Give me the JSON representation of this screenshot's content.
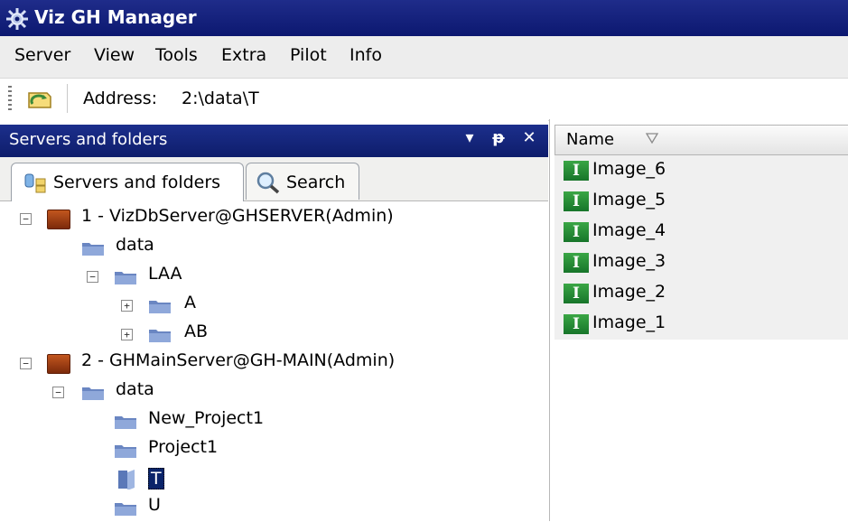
{
  "window": {
    "title": "Viz GH Manager"
  },
  "menu": [
    "Server",
    "View",
    "Tools",
    "Extra",
    "Pilot",
    "Info"
  ],
  "address": {
    "label": "Address:",
    "value": "2:\\data\\T"
  },
  "left_pane": {
    "title": "Servers and folders",
    "buttons": [
      "▾",
      "ᵽ",
      "✕"
    ],
    "tabs": [
      "Servers and folders",
      "Search"
    ],
    "tree": [
      {
        "label": "1 - VizDbServer@GHSERVER(Admin)",
        "type": "server",
        "expander": "−"
      },
      {
        "label": "data",
        "type": "folder",
        "expander": ""
      },
      {
        "label": "LAA",
        "type": "folder",
        "expander": "−"
      },
      {
        "label": "A",
        "type": "folder",
        "expander": "+"
      },
      {
        "label": "AB",
        "type": "folder",
        "expander": "+"
      },
      {
        "label": "2 - GHMainServer@GH-MAIN(Admin)",
        "type": "server",
        "expander": "−"
      },
      {
        "label": "data",
        "type": "folder",
        "expander": "−"
      },
      {
        "label": "New_Project1",
        "type": "folder",
        "expander": ""
      },
      {
        "label": "Project1",
        "type": "folder",
        "expander": ""
      },
      {
        "label": "T",
        "type": "folder-open",
        "expander": "",
        "selected": true
      },
      {
        "label": "U",
        "type": "folder",
        "expander": ""
      }
    ]
  },
  "right_pane": {
    "column": "Name",
    "items": [
      "Image_6",
      "Image_5",
      "Image_4",
      "Image_3",
      "Image_2",
      "Image_1"
    ],
    "item_icon_letter": "I"
  },
  "colors": {
    "title_bar": "#0c1870",
    "image_icon": "#17752a",
    "server_icon": "#a23d10"
  },
  "icons": [
    "gear-icon",
    "refresh-icon",
    "dropdown-icon",
    "pin-icon",
    "close-icon",
    "servers-tab-icon",
    "search-icon",
    "sort-icon"
  ]
}
